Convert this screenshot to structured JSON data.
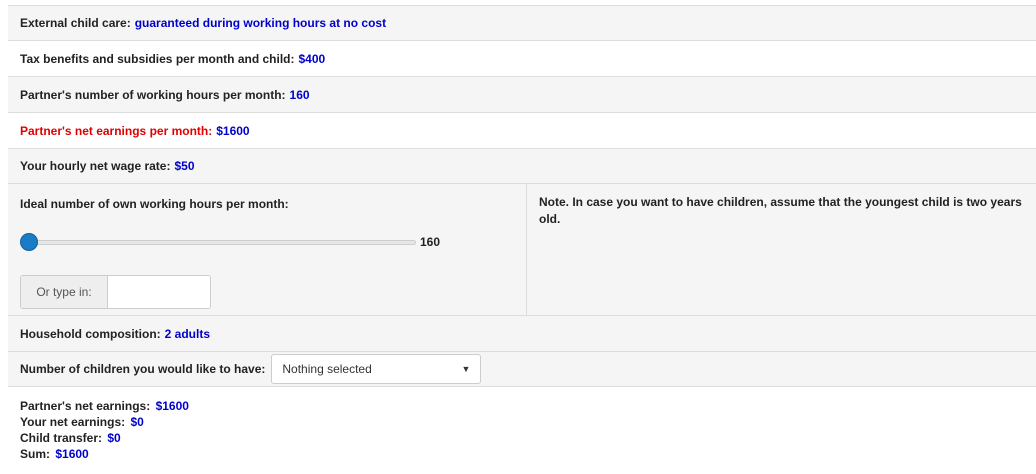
{
  "rows": {
    "childcare": {
      "label": "External child care:",
      "value": "guaranteed during working hours at no cost"
    },
    "tax": {
      "label": "Tax benefits and subsidies per month and child:",
      "value": "$400"
    },
    "partner_hours": {
      "label": "Partner's number of working hours per month:",
      "value": "160"
    },
    "partner_earnings": {
      "label": "Partner's net earnings per month:",
      "value": "$1600"
    },
    "wage": {
      "label": "Your hourly net wage rate:",
      "value": "$50"
    },
    "household": {
      "label": "Household composition:",
      "value": "2 adults"
    }
  },
  "slider": {
    "label": "Ideal number of own working hours per month:",
    "value_text": "160",
    "type_in_label": "Or type in:",
    "type_in_value": ""
  },
  "note": "Note. In case you want to have children, assume that the youngest child is two years old.",
  "children": {
    "label": "Number of children you would like to have:",
    "selected": "Nothing selected"
  },
  "summary": {
    "partner_label": "Partner's net earnings:",
    "partner_value": "$1600",
    "your_label": "Your net earnings:",
    "your_value": "$0",
    "transfer_label": "Child transfer:",
    "transfer_value": "$0",
    "sum_label": "Sum:",
    "sum_value": "$1600"
  },
  "colors": {
    "value": "#0000cc",
    "highlight": "#e00000",
    "slider_thumb": "#1a7bc6"
  }
}
